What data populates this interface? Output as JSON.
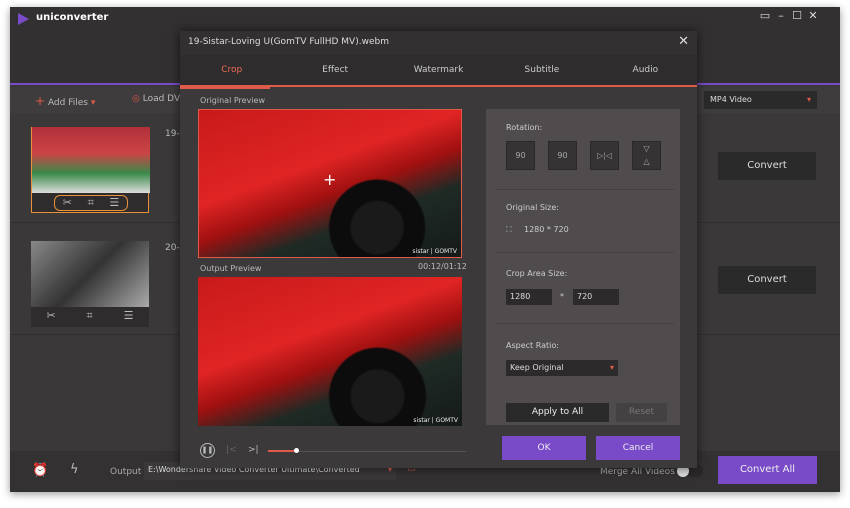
{
  "app": {
    "title": "uniconverter",
    "controls": [
      "▭",
      "–",
      "☐",
      "✕"
    ]
  },
  "toolbar": {
    "add_files": "Add Files",
    "load_dvd": "Load DV",
    "format": "MP4 Video"
  },
  "items": [
    {
      "prefix": "19-",
      "convert": "Convert"
    },
    {
      "prefix": "20-",
      "convert": "Convert"
    }
  ],
  "bottom": {
    "output_label": "Output",
    "output_path": "E:\\Wondershare Video Converter Ultimate\\Converted",
    "merge": "Merge All Videos",
    "merge_on": false,
    "convert_all": "Convert All"
  },
  "dialog": {
    "title": "19-Sistar-Loving U(GomTV FullHD MV).webm",
    "tabs": [
      "Crop",
      "Effect",
      "Watermark",
      "Subtitle",
      "Audio"
    ],
    "active_tab": "Crop",
    "original_preview": "Original Preview",
    "output_preview": "Output Preview",
    "timecode": "00:12/01:12",
    "watermark": "sistar | GOMTV",
    "progress_percent": 14,
    "rotation_label": "Rotation:",
    "rotation_value": "90",
    "original_size_label": "Original Size:",
    "original_size": "1280 * 720",
    "crop_area_label": "Crop Area Size:",
    "crop_w": "1280",
    "crop_sep": "*",
    "crop_h": "720",
    "aspect_label": "Aspect Ratio:",
    "aspect_value": "Keep Original",
    "apply_all": "Apply to All",
    "reset": "Reset",
    "ok": "OK",
    "cancel": "Cancel"
  },
  "colors": {
    "accent": "#7a4bc8",
    "highlight": "#e05a4a"
  }
}
